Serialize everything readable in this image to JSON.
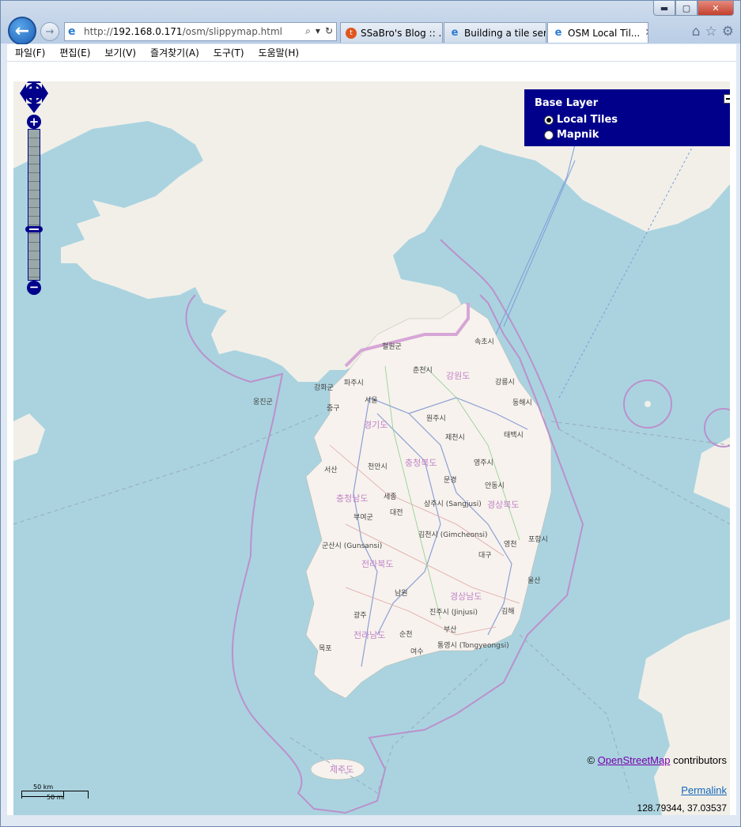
{
  "browser": {
    "url_prefix": "http://",
    "url_host": "192.168.0.171",
    "url_path": "/osm/slippymap.html",
    "tabs": [
      {
        "label": "SSaBro's Blog :: ...",
        "icon": "tistory-icon"
      },
      {
        "label": "Building a tile ser...",
        "icon": "ie-page-icon"
      },
      {
        "label": "OSM Local Til...",
        "icon": "ie-page-icon",
        "active": true
      }
    ],
    "close_tab": "✕"
  },
  "menu": [
    "파일(F)",
    "편집(E)",
    "보기(V)",
    "즐겨찾기(A)",
    "도구(T)",
    "도움말(H)"
  ],
  "layer_switcher": {
    "title": "Base Layer",
    "options": [
      {
        "label": "Local Tiles",
        "checked": true
      },
      {
        "label": "Mapnik",
        "checked": false
      }
    ]
  },
  "attribution": {
    "prefix": "© ",
    "link": "OpenStreetMap",
    "suffix": " contributors"
  },
  "permalink": "Permalink",
  "mouse_position": "128.79344, 37.03537",
  "scale": {
    "km": "50 km",
    "mi": "50 mi"
  },
  "map_labels": {
    "cheorwon": "철원군",
    "chuncheon": "춘천시",
    "gangwon": "강원도",
    "sokcho": "속초시",
    "gangneung": "강릉시",
    "donghae": "동해시",
    "ganghwa": "강화군",
    "paju": "파주시",
    "seoul": "서울",
    "ongjin": "옹진군",
    "junggu": "중구",
    "wonju": "원주시",
    "gyeonggi": "경기도",
    "jecheon": "제천시",
    "taebaek": "태백시",
    "chungbuk": "충청북도",
    "yeongju": "영주시",
    "seosan": "서산",
    "cheonan": "천안시",
    "mungyeong": "문경",
    "andong": "안동시",
    "chungnam": "충청남도",
    "sejong": "세종",
    "sangju": "상주시 (Sangjusi)",
    "gyeongbuk": "경상북도",
    "buyeo": "부여군",
    "daejeon": "대전",
    "gunsan": "군산시 (Gunsansi)",
    "gimcheon": "김천시 (Gimcheonsi)",
    "yeongcheon": "영천",
    "pohang": "포항시",
    "jeonbuk": "전라북도",
    "daegu": "대구",
    "ulsan": "울산",
    "namwon": "남원",
    "gyeongnam": "경상남도",
    "jinju": "진주시 (Jinjusi)",
    "gimhae": "김해",
    "gwangju": "광주",
    "busan": "부산",
    "mokpo": "목포",
    "jeonnam": "전라남도",
    "suncheon": "순천",
    "tongyeong": "통영시 (Tongyeongsi)",
    "yeosu": "여수",
    "jeju": "제주도"
  }
}
